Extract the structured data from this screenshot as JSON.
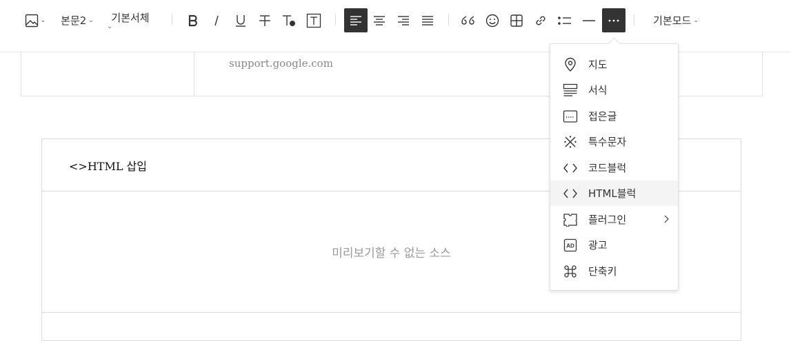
{
  "toolbar": {
    "paragraph_style": "본문2",
    "font_family": "기본서체",
    "mode": "기본모드"
  },
  "content": {
    "link_url": "support.google.com",
    "html_block_title": "<>HTML 삽입",
    "preview_message": "미리보기할 수 없는 소스"
  },
  "more_menu": {
    "items": [
      {
        "label": "지도",
        "icon": "map-pin-icon"
      },
      {
        "label": "서식",
        "icon": "template-icon"
      },
      {
        "label": "접은글",
        "icon": "fold-text-icon"
      },
      {
        "label": "특수문자",
        "icon": "special-char-icon"
      },
      {
        "label": "코드블럭",
        "icon": "code-icon"
      },
      {
        "label": "HTML블럭",
        "icon": "html-code-icon"
      },
      {
        "label": "플러그인",
        "icon": "plugin-icon"
      },
      {
        "label": "광고",
        "icon": "ad-icon"
      },
      {
        "label": "단축키",
        "icon": "shortcut-icon"
      }
    ],
    "highlighted": "HTML블럭"
  },
  "colors": {
    "active_button": "#333333",
    "menu_highlight": "#f4f4f4"
  }
}
